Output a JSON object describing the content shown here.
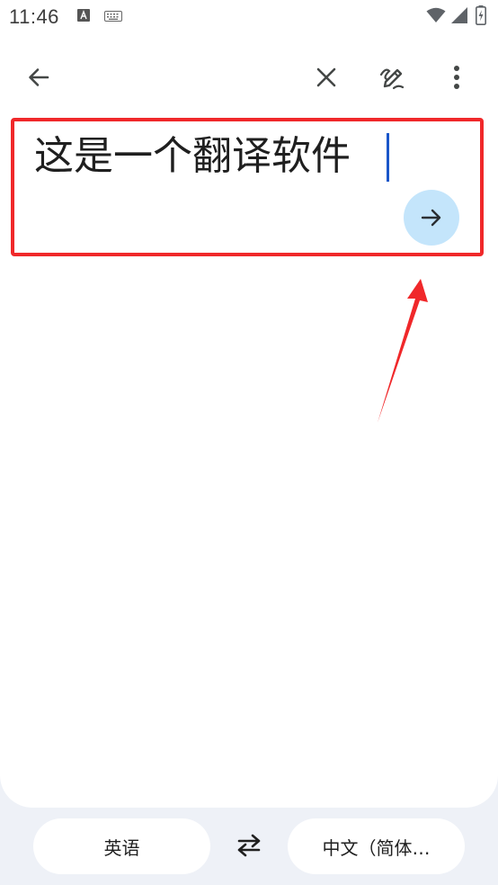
{
  "status_bar": {
    "time": "11:46",
    "icons": [
      "text-a-icon",
      "keyboard-icon",
      "wifi-icon",
      "signal-icon",
      "battery-charging-icon"
    ]
  },
  "toolbar": {
    "icons": [
      "back-arrow-icon",
      "close-icon",
      "handwriting-pen-icon",
      "more-vert-icon"
    ]
  },
  "input": {
    "text": "这是一个翻译软件",
    "submit_icon": "arrow-right-icon"
  },
  "language_bar": {
    "source_language": "英语",
    "target_language": "中文（简体…",
    "swap_icon": "swap-arrows-icon"
  },
  "colors": {
    "accent_circle": "#c4e5fb",
    "highlight_red": "#f0282a",
    "cursor_blue": "#1a56c9",
    "background": "#eef1f7"
  }
}
